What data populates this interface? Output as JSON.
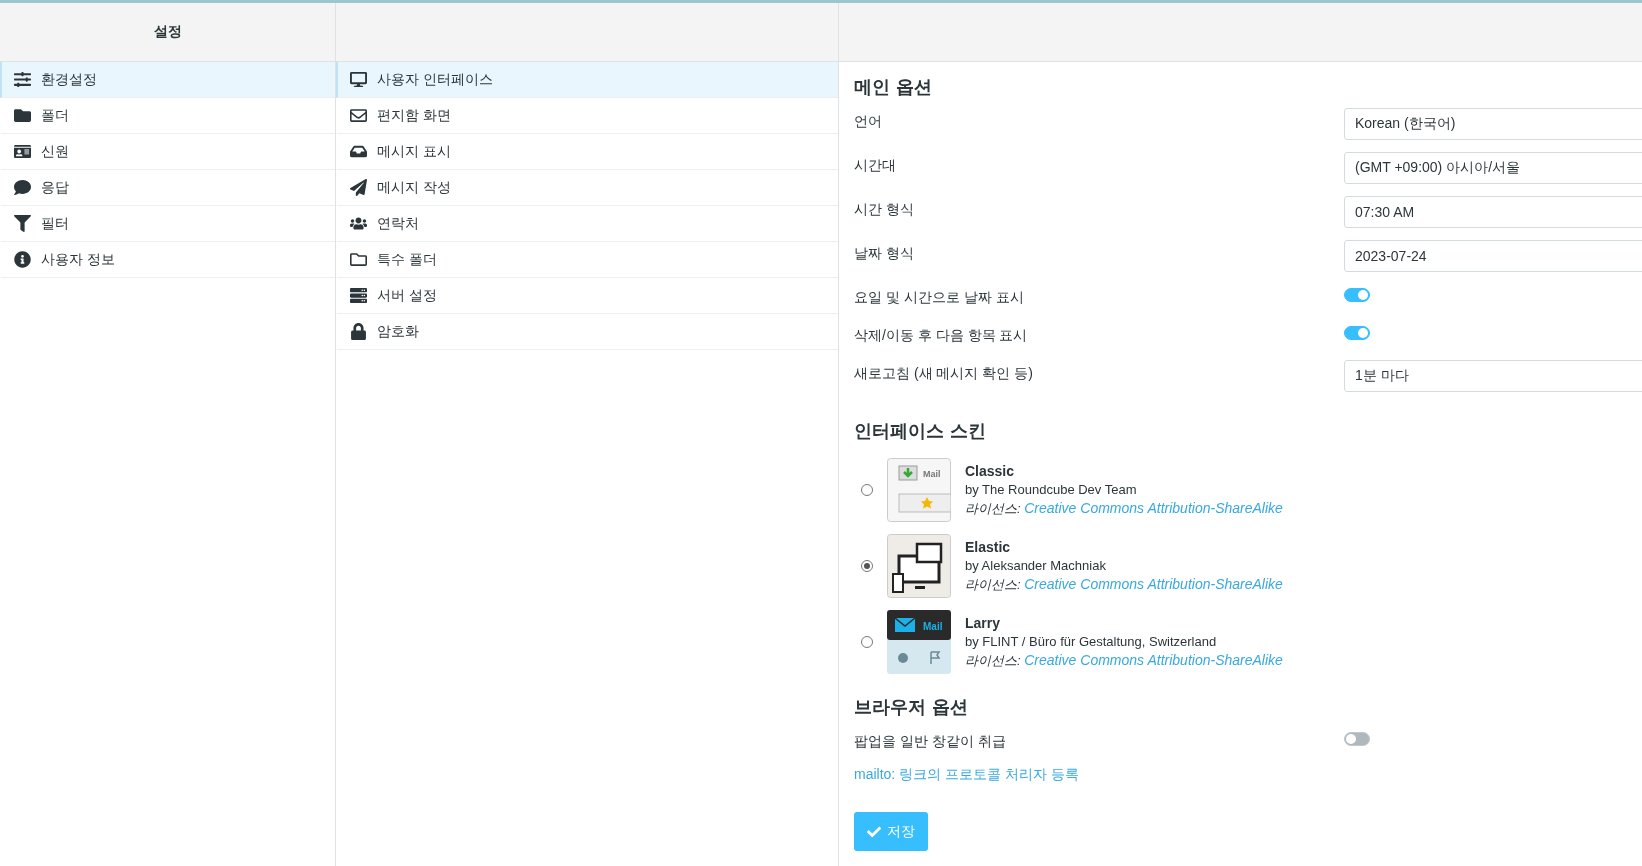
{
  "header": {
    "title": "설정"
  },
  "sections": [
    {
      "label": "환경설정",
      "selected": true
    },
    {
      "label": "폴더",
      "selected": false
    },
    {
      "label": "신원",
      "selected": false
    },
    {
      "label": "응답",
      "selected": false
    },
    {
      "label": "필터",
      "selected": false
    },
    {
      "label": "사용자 정보",
      "selected": false
    }
  ],
  "subsections": [
    {
      "label": "사용자 인터페이스",
      "selected": true
    },
    {
      "label": "편지함 화면",
      "selected": false
    },
    {
      "label": "메시지 표시",
      "selected": false
    },
    {
      "label": "메시지 작성",
      "selected": false
    },
    {
      "label": "연락처",
      "selected": false
    },
    {
      "label": "특수 폴더",
      "selected": false
    },
    {
      "label": "서버 설정",
      "selected": false
    },
    {
      "label": "암호화",
      "selected": false
    }
  ],
  "main_options": {
    "title": "메인 옵션",
    "rows": [
      {
        "kind": "select",
        "label": "언어",
        "value": "Korean (한국어)"
      },
      {
        "kind": "select",
        "label": "시간대",
        "value": "(GMT +09:00) 아시아/서울"
      },
      {
        "kind": "select",
        "label": "시간 형식",
        "value": "07:30 AM"
      },
      {
        "kind": "select",
        "label": "날짜 형식",
        "value": "2023-07-24"
      },
      {
        "kind": "toggle",
        "label": "요일 및 시간으로 날짜 표시",
        "on": true
      },
      {
        "kind": "toggle",
        "label": "삭제/이동 후 다음 항목 표시",
        "on": true
      },
      {
        "kind": "select",
        "label": "새로고침 (새 메시지 확인 등)",
        "value": "1분 마다"
      }
    ]
  },
  "skins": {
    "title": "인터페이스 스킨",
    "items": [
      {
        "name": "Classic",
        "author": "by The Roundcube Dev Team",
        "license_label": "라이선스:",
        "license": "Creative Commons Attribution-ShareAlike",
        "selected": false,
        "thumb_text": "Mail"
      },
      {
        "name": "Elastic",
        "author": "by Aleksander Machniak",
        "license_label": "라이선스:",
        "license": "Creative Commons Attribution-ShareAlike",
        "selected": true
      },
      {
        "name": "Larry",
        "author": "by FLINT / Büro für Gestaltung, Switzerland",
        "license_label": "라이선스:",
        "license": "Creative Commons Attribution-ShareAlike",
        "selected": false,
        "thumb_text": "Mail"
      }
    ]
  },
  "browser_options": {
    "title": "브라우저 옵션",
    "rows": [
      {
        "kind": "toggle",
        "label": "팝업을 일반 창같이 취급",
        "on": false
      }
    ],
    "link": "mailto: 링크의 프로토콜 처리자 등록"
  },
  "save_button": "저장"
}
